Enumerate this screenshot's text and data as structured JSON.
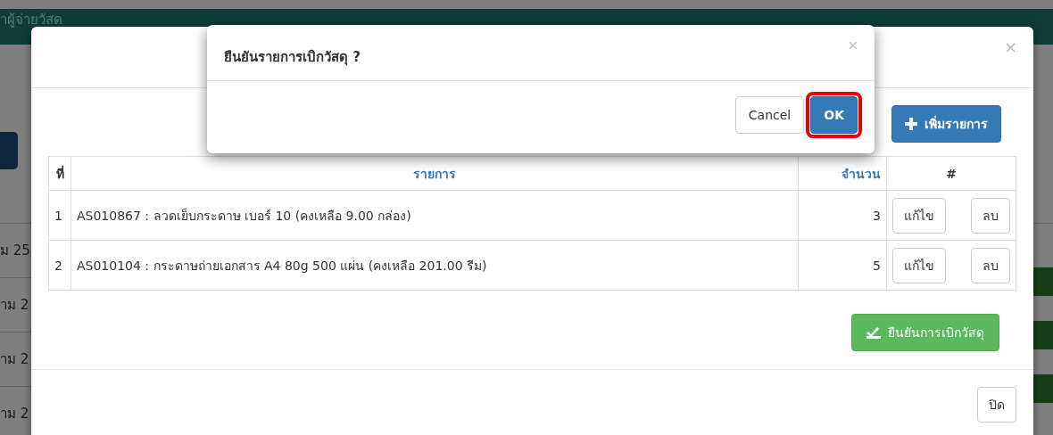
{
  "background_page": {
    "header_title": "าผู้จ่ายวัสด",
    "row_labels": [
      "ม 25",
      "าม 2",
      "าม 2",
      "าม 2"
    ]
  },
  "modal": {
    "close_icon": "×",
    "add_button": "เพิ่มรายการ",
    "table": {
      "columns": [
        "ที่",
        "รายการ",
        "จำนวน",
        "#"
      ],
      "rows": [
        {
          "no": "1",
          "item": "AS010867 : ลวดเย็บกระดาษ เบอร์ 10 (คงเหลือ 9.00 กล่อง)",
          "qty": "3",
          "edit": "แก้ไข",
          "delete": "ลบ"
        },
        {
          "no": "2",
          "item": "AS010104 : กระดาษถ่ายเอกสาร A4 80g 500 แผ่น (คงเหลือ 201.00 รีม)",
          "qty": "5",
          "edit": "แก้ไข",
          "delete": "ลบ"
        }
      ]
    },
    "confirm_button": "ยืนยันการเบิกวัสดุ",
    "close_button": "ปิด"
  },
  "confirm_dialog": {
    "title": "ยืนยันรายการเบิกวัสดุ ?",
    "close_icon": "×",
    "cancel_button": "Cancel",
    "ok_button": "OK",
    "ok_highlighted": true
  }
}
